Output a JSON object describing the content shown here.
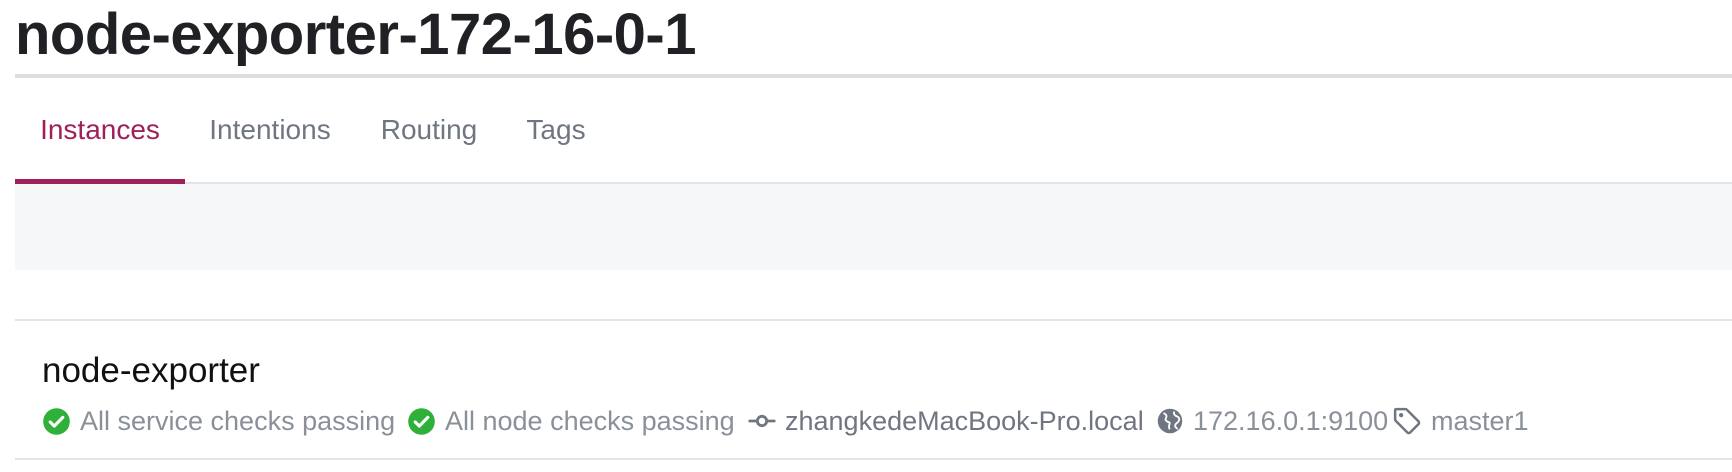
{
  "title": "node-exporter-172-16-0-1",
  "tabs": [
    {
      "label": "Instances",
      "active": true
    },
    {
      "label": "Intentions",
      "active": false
    },
    {
      "label": "Routing",
      "active": false
    },
    {
      "label": "Tags",
      "active": false
    }
  ],
  "instance": {
    "name": "node-exporter",
    "service_checks": "All service checks passing",
    "node_checks": "All node checks passing",
    "node": "zhangkedeMacBook-Pro.local",
    "address": "172.16.0.1:9100",
    "tag": "master1"
  },
  "colors": {
    "accent": "#9e2159",
    "passing": "#2eb039",
    "muted_text": "#8a9099",
    "band": "#f6f7f8"
  },
  "icons": {
    "check": "check-circle-icon",
    "node": "git-commit-icon",
    "address": "globe-icon",
    "tag": "tag-icon"
  }
}
